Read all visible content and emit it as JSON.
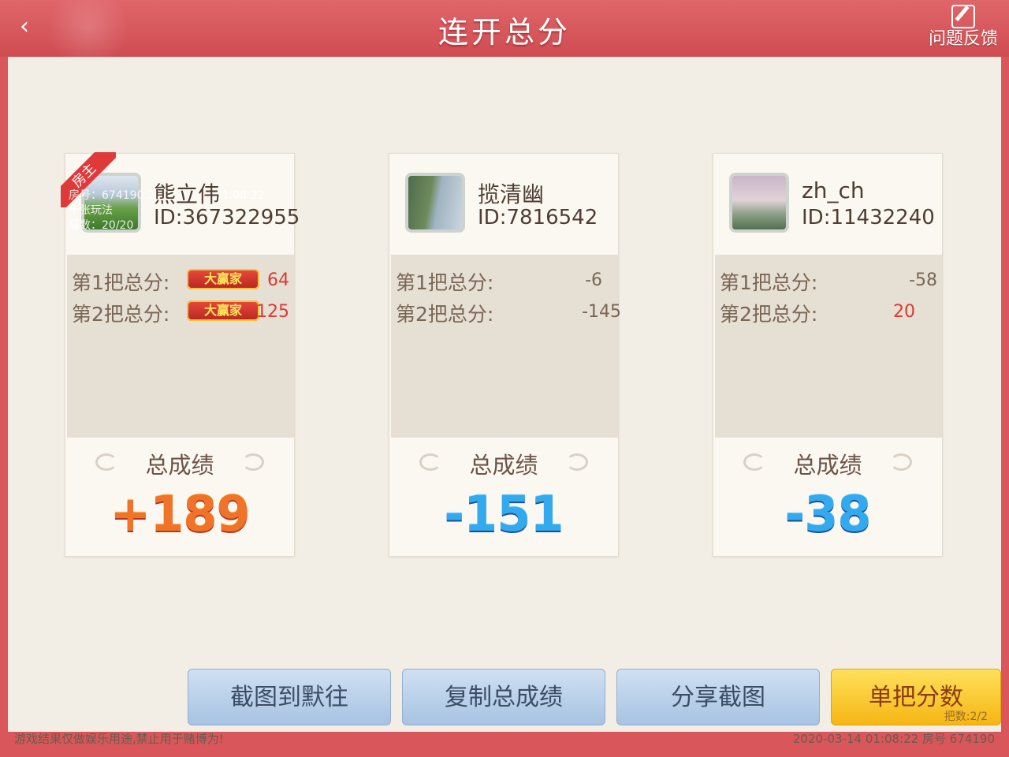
{
  "header": {
    "title": "连开总分",
    "back_icon": "chevron-left-icon",
    "feedback_label": "问题反馈"
  },
  "players": [
    {
      "name": "熊立伟",
      "id_text": "ID:367322955",
      "host_badge": "房主",
      "watermark": [
        "房号：674190  2020-03-14 01:08:22",
        "十张玩法",
        "局数：20/20"
      ],
      "rounds": [
        {
          "label": "第1把总分:",
          "badge": "大赢家",
          "value": "64"
        },
        {
          "label": "第2把总分:",
          "badge": "大赢家",
          "value": "125"
        }
      ],
      "total_label": "总成绩",
      "total": "+189"
    },
    {
      "name": "揽清幽",
      "id_text": "ID:7816542",
      "rounds": [
        {
          "label": "第1把总分:",
          "value": "-6"
        },
        {
          "label": "第2把总分:",
          "value": "-145"
        }
      ],
      "total_label": "总成绩",
      "total": "-151"
    },
    {
      "name": "zh_ch",
      "id_text": "ID:11432240",
      "rounds": [
        {
          "label": "第1把总分:",
          "value": "-58"
        },
        {
          "label": "第2把总分:",
          "value": "20"
        }
      ],
      "total_label": "总成绩",
      "total": "-38"
    }
  ],
  "buttons": {
    "screenshot_to_contact": "截图到默往",
    "copy_total": "复制总成绩",
    "share_screenshot": "分享截图",
    "single_round_score": "单把分数",
    "round_count": "把数:2/2"
  },
  "footer": {
    "disclaimer": "游戏结果仅做娱乐用途,禁止用于赌博为!",
    "info": "2020-03-14 01:08:22 房号 674190"
  },
  "colors": {
    "header_red": "#d9575a",
    "panel_bg": "#f3eee5",
    "positive": "#f0732a",
    "negative": "#33a9ee",
    "gold_button": "#f5b613"
  }
}
